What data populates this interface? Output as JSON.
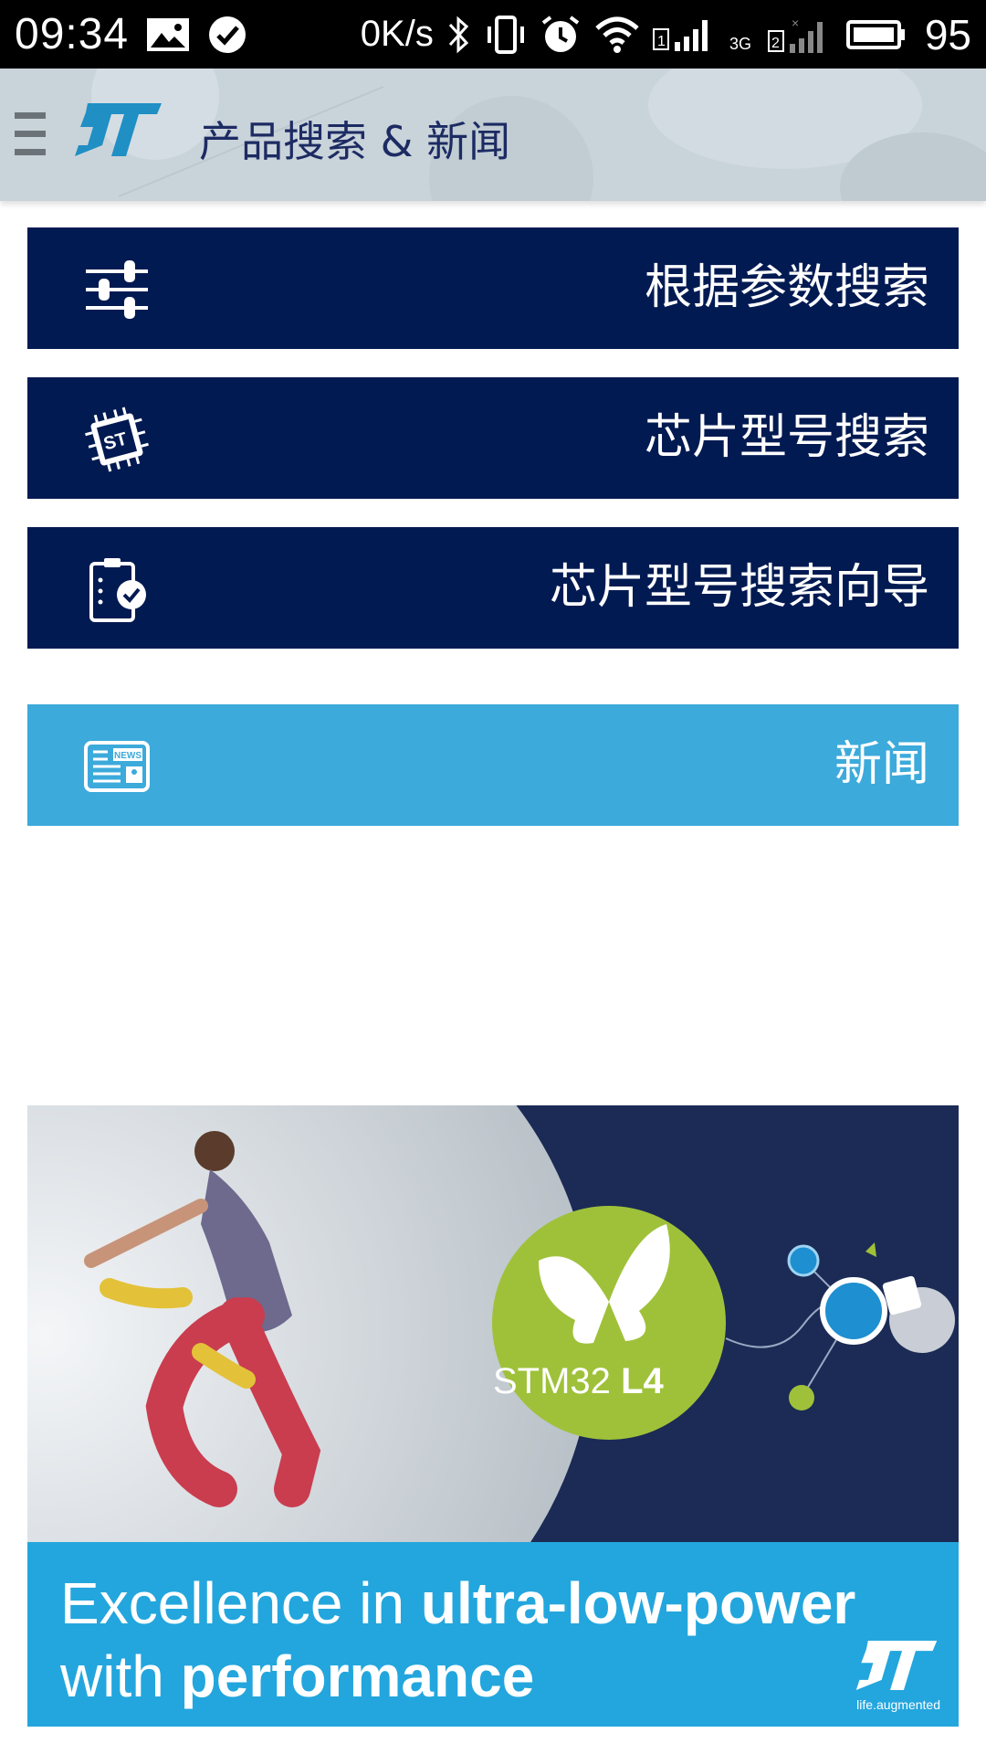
{
  "status_bar": {
    "time": "09:34",
    "speed": "0K/s",
    "battery_percent": "95",
    "icons": [
      "image-icon",
      "check-circle-icon",
      "bluetooth-icon",
      "vibrate-icon",
      "alarm-icon",
      "wifi-icon",
      "sim1-signal-icon",
      "network-3g-icon",
      "sim2-signal-icon",
      "battery-icon"
    ]
  },
  "app_bar": {
    "title": "产品搜索 & 新闻",
    "logo": "st-logo",
    "menu_icon": "hamburger-menu-icon"
  },
  "menu": {
    "items": [
      {
        "label": "根据参数搜索",
        "icon": "sliders-icon"
      },
      {
        "label": "芯片型号搜索",
        "icon": "chip-icon"
      },
      {
        "label": "芯片型号搜索向导",
        "icon": "clipboard-check-icon"
      },
      {
        "label": "新闻",
        "icon": "newspaper-icon"
      }
    ]
  },
  "banner": {
    "product": "STM32",
    "product_series": "L4",
    "headline_line1_regular": "Excellence in ",
    "headline_line1_bold": "ultra-low-power",
    "headline_line2_regular": "with ",
    "headline_line2_bold": "performance",
    "tagline": "life.augmented"
  },
  "colors": {
    "primary_dark": "#021a52",
    "news_blue": "#3caadb",
    "banner_blue": "#23a6dd",
    "banner_navy": "#1b2b55",
    "stm_green": "#9fc13a"
  }
}
